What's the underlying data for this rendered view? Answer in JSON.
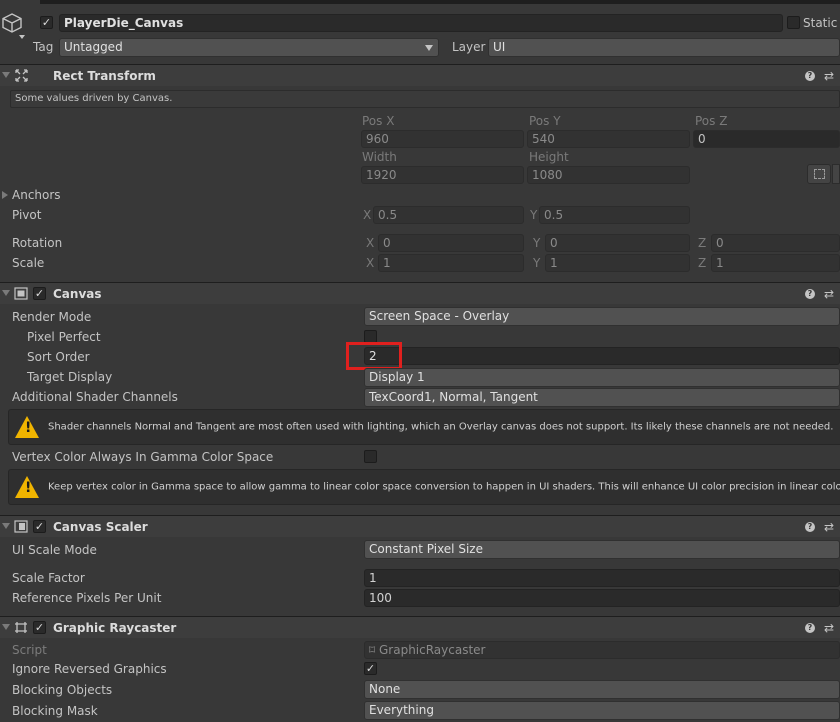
{
  "gameobject": {
    "name": "PlayerDie_Canvas",
    "static_label": "Static",
    "tag_label": "Tag",
    "tag_value": "Untagged",
    "layer_label": "Layer",
    "layer_value": "UI"
  },
  "rect_transform": {
    "title": "Rect Transform",
    "driven_note": "Some values driven by Canvas.",
    "pos_x_label": "Pos X",
    "pos_x": "960",
    "pos_y_label": "Pos Y",
    "pos_y": "540",
    "pos_z_label": "Pos Z",
    "pos_z": "0",
    "width_label": "Width",
    "width": "1920",
    "height_label": "Height",
    "height": "1080",
    "anchors_label": "Anchors",
    "pivot_label": "Pivot",
    "pivot_x": "0.5",
    "pivot_y": "0.5",
    "rotation_label": "Rotation",
    "rot_x": "0",
    "rot_y": "0",
    "rot_z": "0",
    "scale_label": "Scale",
    "scale_x": "1",
    "scale_y": "1",
    "scale_z": "1",
    "axis_x": "X",
    "axis_y": "Y",
    "axis_z": "Z"
  },
  "canvas": {
    "title": "Canvas",
    "render_mode_label": "Render Mode",
    "render_mode": "Screen Space - Overlay",
    "pixel_perfect_label": "Pixel Perfect",
    "sort_order_label": "Sort Order",
    "sort_order": "2",
    "target_display_label": "Target Display",
    "target_display": "Display 1",
    "shader_channels_label": "Additional Shader Channels",
    "shader_channels": "TexCoord1, Normal, Tangent",
    "shader_warning": "Shader channels Normal and Tangent are most often used with lighting, which an Overlay canvas does not support. Its likely these channels are not needed.",
    "vertex_color_label": "Vertex Color Always In Gamma Color Space",
    "vertex_warning": "Keep vertex color in Gamma space to allow gamma to linear color space conversion to happen in UI shaders. This will enhance UI color precision in linear color space."
  },
  "canvas_scaler": {
    "title": "Canvas Scaler",
    "ui_scale_mode_label": "UI Scale Mode",
    "ui_scale_mode": "Constant Pixel Size",
    "scale_factor_label": "Scale Factor",
    "scale_factor": "1",
    "ref_pixels_label": "Reference Pixels Per Unit",
    "ref_pixels": "100"
  },
  "graphic_raycaster": {
    "title": "Graphic Raycaster",
    "script_label": "Script",
    "script": "GraphicRaycaster",
    "ignore_reversed_label": "Ignore Reversed Graphics",
    "blocking_objects_label": "Blocking Objects",
    "blocking_objects": "None",
    "blocking_mask_label": "Blocking Mask",
    "blocking_mask": "Everything"
  },
  "colors": {
    "highlight": "#e0201e",
    "warning": "#f0b400"
  },
  "icons": [
    "gameobject-cube-icon",
    "rect-transform-icon",
    "canvas-icon",
    "canvas-scaler-icon",
    "graphic-raycaster-icon",
    "help-icon",
    "settings-sliders-icon",
    "warning-icon",
    "checkmark-icon"
  ]
}
